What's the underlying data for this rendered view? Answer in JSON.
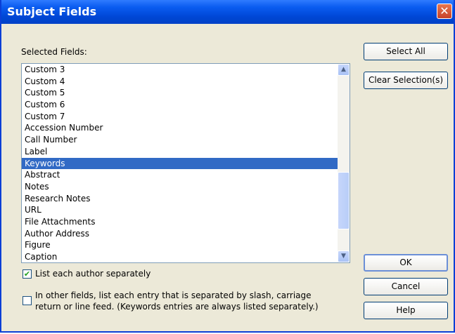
{
  "window": {
    "title": "Subject Fields",
    "close_glyph": "✕"
  },
  "selected_fields_label": "Selected Fields:",
  "fields": [
    {
      "label": "Custom 3"
    },
    {
      "label": "Custom 4"
    },
    {
      "label": "Custom 5"
    },
    {
      "label": "Custom 6"
    },
    {
      "label": "Custom 7"
    },
    {
      "label": "Accession Number"
    },
    {
      "label": "Call Number"
    },
    {
      "label": "Label"
    },
    {
      "label": "Keywords",
      "selected": true
    },
    {
      "label": "Abstract"
    },
    {
      "label": "Notes"
    },
    {
      "label": "Research Notes"
    },
    {
      "label": "URL"
    },
    {
      "label": "File Attachments"
    },
    {
      "label": "Author Address"
    },
    {
      "label": "Figure"
    },
    {
      "label": "Caption"
    }
  ],
  "buttons": {
    "select_all": "Select All",
    "clear_selection": "Clear Selection(s)",
    "ok": "OK",
    "cancel": "Cancel",
    "help": "Help"
  },
  "scrollbar": {
    "up_glyph": "▲",
    "down_glyph": "▼"
  },
  "options": {
    "list_author_separately": {
      "label": "List each author separately",
      "checked": true,
      "check_glyph": "✔"
    },
    "list_other_fields": {
      "label_line1": "In other fields, list each entry that is separated by slash, carriage",
      "label_line2": "return or line feed. (Keywords entries are always listed separately.)",
      "checked": false
    }
  },
  "colors": {
    "titlebar": "#0047d5",
    "selection": "#316ac5",
    "dialog_bg": "#ece9d8"
  }
}
